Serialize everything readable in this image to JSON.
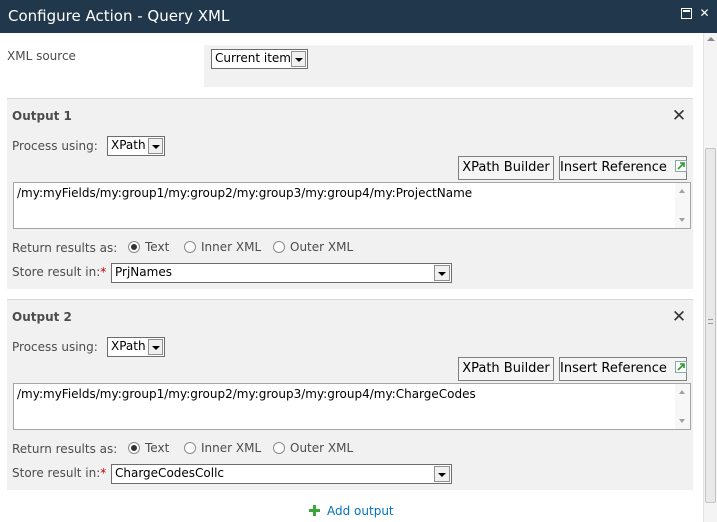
{
  "window": {
    "title": "Configure Action - Query XML",
    "maximize_icon": "maximize-icon",
    "close_icon": "close-icon",
    "close_glyph": "✕",
    "title_bar_color": "#21374c"
  },
  "xml_source": {
    "label": "XML source",
    "value": "Current item"
  },
  "outputs": [
    {
      "title": "Output 1",
      "remove_glyph": "✕",
      "process_label": "Process using:",
      "process_value": "XPath",
      "xpath_builder_label": "XPath Builder",
      "insert_reference_label": "Insert Reference",
      "xpath": "/my:myFields/my:group1/my:group2/my:group3/my:group4/my:ProjectName",
      "return_label": "Return results as:",
      "return_options": [
        "Text",
        "Inner XML",
        "Outer XML"
      ],
      "return_selected": "Text",
      "store_label": "Store result in:",
      "required_mark": "*",
      "store_value": "PrjNames"
    },
    {
      "title": "Output 2",
      "remove_glyph": "✕",
      "process_label": "Process using:",
      "process_value": "XPath",
      "xpath_builder_label": "XPath Builder",
      "insert_reference_label": "Insert Reference",
      "xpath": "/my:myFields/my:group1/my:group2/my:group3/my:group4/my:ChargeCodes",
      "return_label": "Return results as:",
      "return_options": [
        "Text",
        "Inner XML",
        "Outer XML"
      ],
      "return_selected": "Text",
      "store_label": "Store result in:",
      "required_mark": "*",
      "store_value": "ChargeCodesCollc"
    }
  ],
  "add_output_label": "Add output",
  "colors": {
    "panel": "#f1f1f1",
    "link": "#0072bc",
    "required": "#bf0000",
    "add_icon": "#3aa63a"
  }
}
